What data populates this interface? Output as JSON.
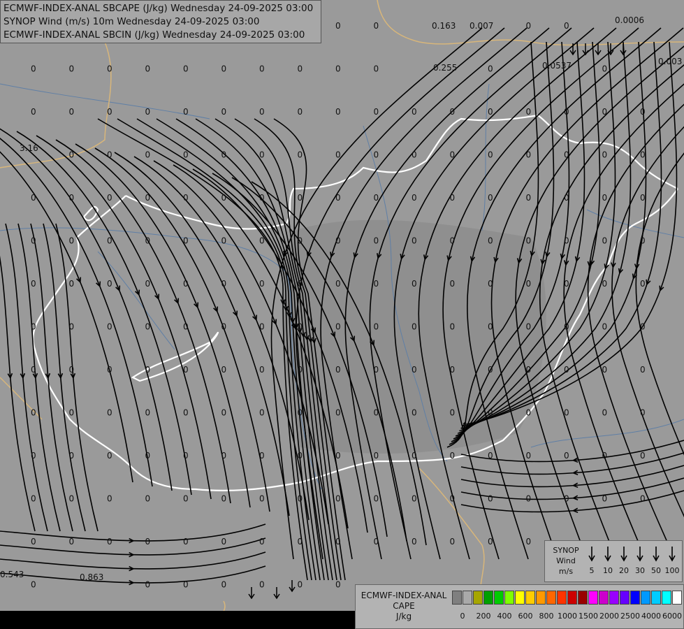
{
  "titles": {
    "line1": "ECMWF-INDEX-ANAL SBCAPE (J/kg) Wednesday 24-09-2025 03:00",
    "line2": "SYNOP Wind (m/s) 10m Wednesday 24-09-2025 03:00",
    "line3": "ECMWF-INDEX-ANAL SBCIN (J/kg) Wednesday 24-09-2025 03:00"
  },
  "synop_legend": {
    "label_line1": "SYNOP",
    "label_line2": "Wind",
    "label_line3": "m/s",
    "speeds": [
      "5",
      "10",
      "20",
      "30",
      "50",
      "100"
    ]
  },
  "cape_legend": {
    "label_line1": "ECMWF-INDEX-ANAL",
    "label_line2": "CAPE",
    "label_line3": "J/kg",
    "colors": [
      "#7f7f7f",
      "#a9a9a9",
      "#a6a600",
      "#00a000",
      "#00cc00",
      "#7fff00",
      "#ffff00",
      "#ffcc00",
      "#ff9900",
      "#ff6600",
      "#ff3300",
      "#cc0000",
      "#990000",
      "#ff00ff",
      "#cc00cc",
      "#9900ff",
      "#6600ff",
      "#0000ff",
      "#0099ff",
      "#00ccff",
      "#00ffff",
      "#ffffff"
    ],
    "ticks": [
      "0",
      "200",
      "400",
      "600",
      "800",
      "1000",
      "1500",
      "2000",
      "2500",
      "4000",
      "6000"
    ]
  },
  "map_colors": {
    "background": "#9a9a9a",
    "border_white": "#ffffff",
    "border_tan": "#d8b67a",
    "river": "#5f7fa6",
    "streamline": "#000000",
    "lowland": "#8f8f8f"
  },
  "cape_values": {
    "grid_zero": "0",
    "special": [
      "0.163",
      "0.007",
      "0.0006",
      "0.255",
      "0.0537",
      "0.003",
      "3.16",
      "0.543",
      "0.863"
    ]
  }
}
